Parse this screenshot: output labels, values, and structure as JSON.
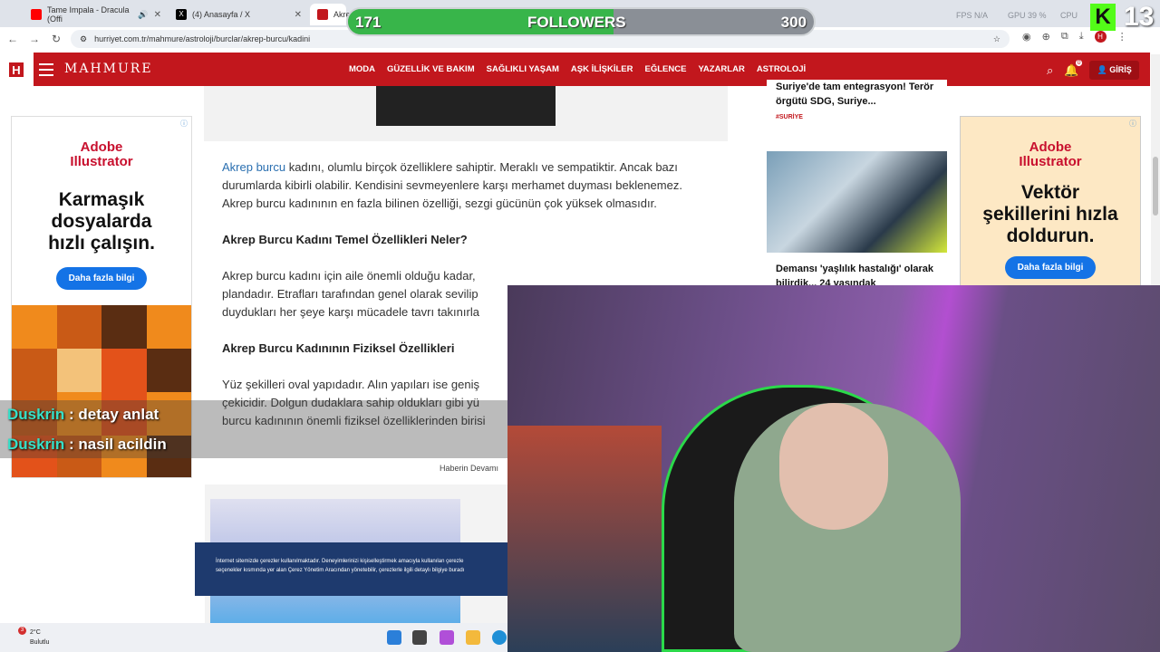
{
  "browser": {
    "tabs": [
      {
        "label": "Tame Impala - Dracula (Offi",
        "icon": "youtube-icon",
        "color": "#ff0000"
      },
      {
        "label": "(4) Anasayfa / X",
        "icon": "x-icon",
        "color": "#000000"
      },
      {
        "label": "Akrep",
        "icon": "hurriyet-icon",
        "color": "#c2171d"
      }
    ],
    "url": "hurriyet.com.tr/mahmure/astroloji/burclar/akrep-burcu/kadini",
    "system_stats": [
      "FPS N/A",
      "GPU 39 %",
      "CPU"
    ]
  },
  "site": {
    "logo_letter": "H",
    "brand": "MAHMURE",
    "menu": [
      "MODA",
      "GÜZELLİK VE BAKIM",
      "SAĞLIKLI YAŞAM",
      "AŞK İLİŞKİLER",
      "EĞLENCE",
      "YAZARLAR",
      "ASTROLOJİ"
    ],
    "login_label": "GİRİŞ",
    "notification_count": "0"
  },
  "ads": {
    "left": {
      "brand_line1": "Adobe",
      "brand_line2": "Illustrator",
      "headline": "Karmaşık dosyalarda hızlı çalışın.",
      "button": "Daha fazla bilgi"
    },
    "right": {
      "brand_line1": "Adobe",
      "brand_line2": "Illustrator",
      "headline": "Vektör şekillerini hızla doldurun.",
      "button": "Daha fazla bilgi"
    }
  },
  "article": {
    "p1_link": "Akrep burcu",
    "p1_rest": " kadını, olumlu birçok özelliklere sahiptir. Meraklı ve sempatiktir. Ancak bazı durumlarda kibirli olabilir. Kendisini sevmeyenlere karşı merhamet duyması beklenemez. Akrep burcu kadınının en fazla bilinen özelliği, sezgi gücünün çok yüksek olmasıdır.",
    "h1": "Akrep Burcu Kadını Temel Özellikleri Neler?",
    "p2": "Akrep burcu kadını için aile önemli olduğu kadar, plandadır. Etrafları tarafından genel olarak sevilip duydukları her şeye karşı mücadele tavrı takınırla",
    "h2": "Akrep Burcu Kadınının Fiziksel Özellikleri",
    "p3": "Yüz şekilleri oval yapıdadır. Alın yapıları ise geniş çekicidir. Dolgun dudaklara sahip oldukları gibi yü burcu kadınının önemli fiziksel özelliklerinden birisi",
    "read_more": "Haberin Devamı"
  },
  "sidebar_news": [
    {
      "title": "Suriye'de tam entegrasyon! Terör örgütü SDG, Suriye...",
      "tag": "#SURİYE"
    },
    {
      "title": "Demansı 'yaşlılık hastalığı' olarak bilirdik... 24 yaşındak"
    }
  ],
  "cookie_banner": {
    "line1": "İnternet sitemizde çerezler kullanılmaktadır. Deneyimlerinizi kişiselleştirmek amacıyla kullanılan çerezle",
    "line2": "seçenekler kısmında yer alan Çerez Yönetim Aracından yönetebilir, çerezlerle ilgili detaylı bilgiye buradı"
  },
  "chat": [
    {
      "user": "Duskrin",
      "message": " : detay anlat"
    },
    {
      "user": "Duskrin",
      "message": " : nasil acildin"
    }
  ],
  "followers_goal": {
    "current": "171",
    "label": "FOLLOWERS",
    "target": "300",
    "progress": 0.57
  },
  "kick_badge": {
    "letter": "K",
    "number": "13"
  },
  "taskbar": {
    "temperature": "2°C",
    "condition": "Bulutlu",
    "badge": "3"
  },
  "colors": {
    "brand_red": "#c2171d",
    "adobe_red": "#c8102e",
    "adobe_blue": "#1473e6",
    "kick_green": "#53fc18",
    "chat_user": "#36e0c8"
  }
}
